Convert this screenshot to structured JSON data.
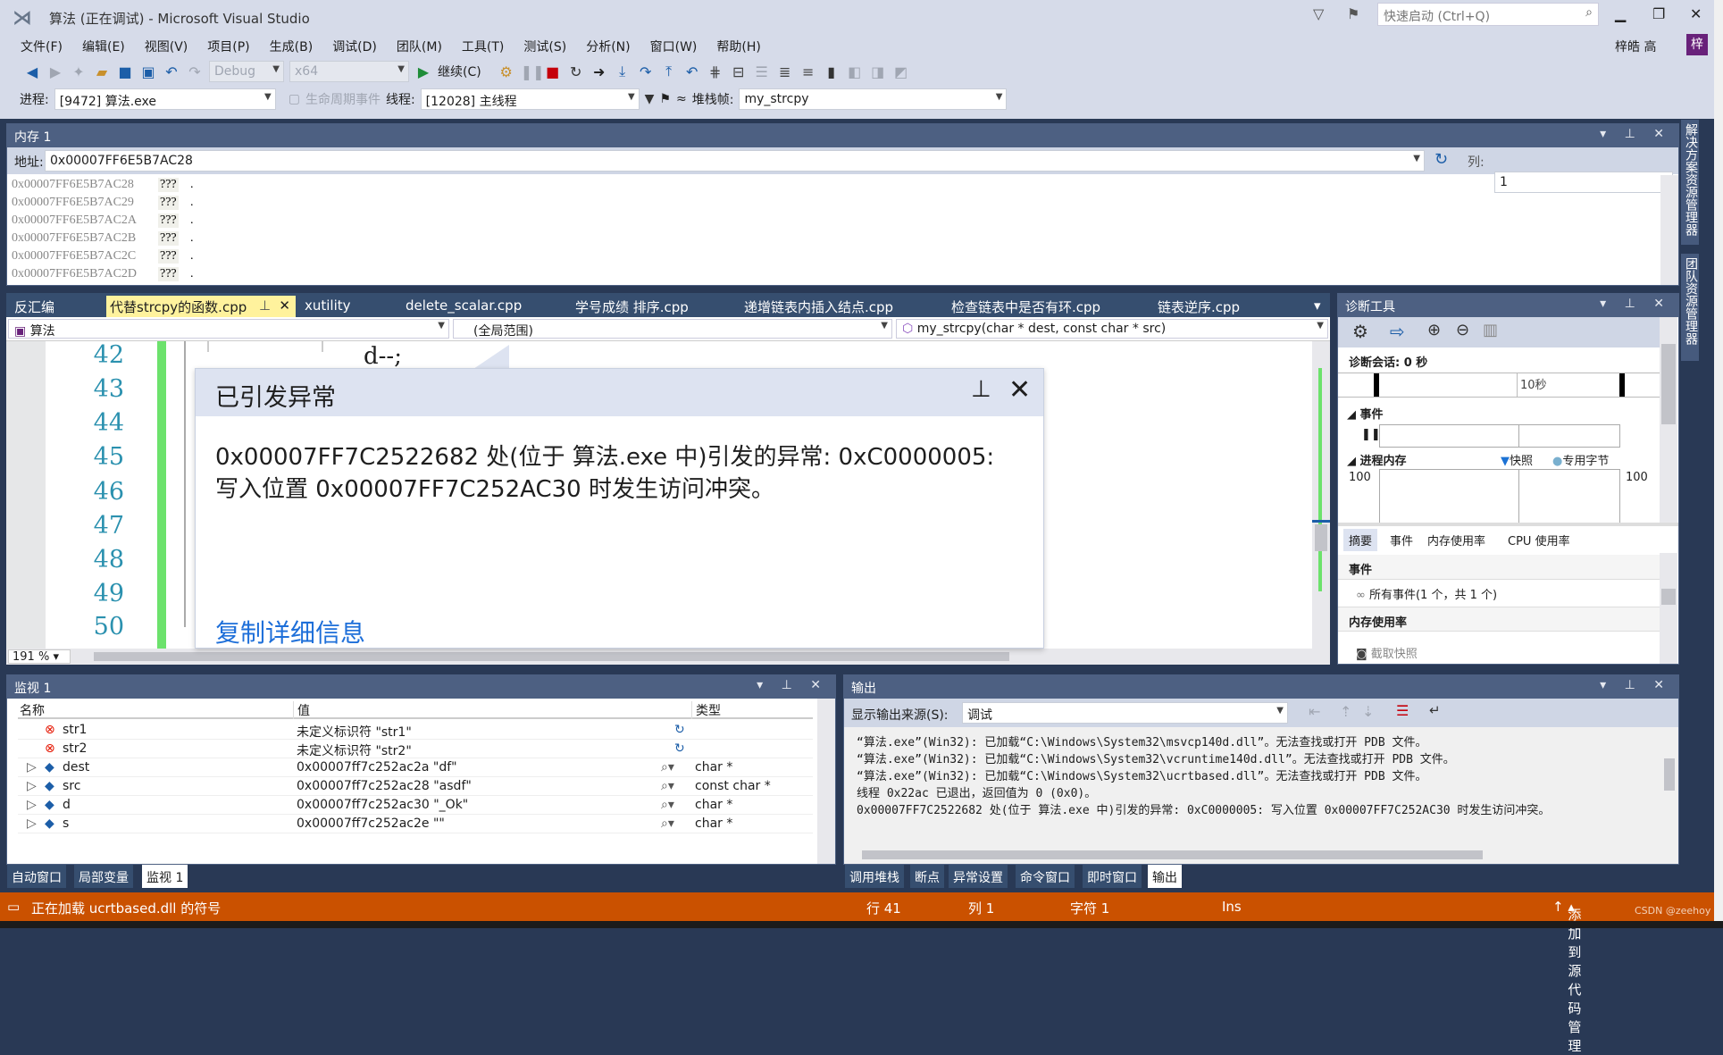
{
  "window": {
    "title": "算法 (正在调试) - Microsoft Visual Studio",
    "quick_launch_placeholder": "快速启动 (Ctrl+Q)",
    "user": "梓皓 高",
    "avatar": "梓"
  },
  "menu": [
    "文件(F)",
    "编辑(E)",
    "视图(V)",
    "项目(P)",
    "生成(B)",
    "调试(D)",
    "团队(M)",
    "工具(T)",
    "测试(S)",
    "分析(N)",
    "窗口(W)",
    "帮助(H)"
  ],
  "toolbar": {
    "config": "Debug",
    "platform": "x64",
    "continue": "继续(C)"
  },
  "debug_location": {
    "process_label": "进程:",
    "process": "[9472] 算法.exe",
    "lifecycle": "生命周期事件",
    "thread_label": "线程:",
    "thread": "[12028] 主线程",
    "stackframe_label": "堆栈帧:",
    "stackframe": "my_strcpy"
  },
  "memory": {
    "title": "内存 1",
    "address_label": "地址:",
    "address": "0x00007FF6E5B7AC28",
    "columns_label": "列:",
    "columns": "1",
    "rows": [
      {
        "addr": "0x00007FF6E5B7AC28",
        "val": "???",
        "ch": "."
      },
      {
        "addr": "0x00007FF6E5B7AC29",
        "val": "???",
        "ch": "."
      },
      {
        "addr": "0x00007FF6E5B7AC2A",
        "val": "???",
        "ch": "."
      },
      {
        "addr": "0x00007FF6E5B7AC2B",
        "val": "???",
        "ch": "."
      },
      {
        "addr": "0x00007FF6E5B7AC2C",
        "val": "???",
        "ch": "."
      },
      {
        "addr": "0x00007FF6E5B7AC2D",
        "val": "???",
        "ch": "."
      }
    ]
  },
  "editor": {
    "tabs": [
      "反汇编",
      "代替strcpy的函数.cpp",
      "xutility",
      "delete_scalar.cpp",
      "学号成绩 排序.cpp",
      "递增链表内插入结点.cpp",
      "检查链表中是否有环.cpp",
      "链表逆序.cpp"
    ],
    "active_tab": 1,
    "nav_project": "算法",
    "nav_scope": "(全局范围)",
    "nav_member": "my_strcpy(char * dest, const char * src)",
    "line_numbers": [
      "42",
      "43",
      "44",
      "45",
      "46",
      "47",
      "48",
      "49",
      "50"
    ],
    "code_line_42": "d--;",
    "zoom": "191 %"
  },
  "exception": {
    "title": "已引发异常",
    "message_line1": "0x00007FF7C2522682 处(位于 算法.exe 中)引发的异常: 0xC0000005:",
    "message_line2": "写入位置 0x00007FF7C252AC30 时发生访问冲突。",
    "copy_details": "复制详细信息"
  },
  "diagnostics": {
    "title": "诊断工具",
    "session": "诊断会话: 0 秒",
    "timeline_tick": "10秒",
    "events_section": "事件",
    "memory_section": "进程内存",
    "legend_snapshot": "快照",
    "legend_private": "专用字节",
    "axis_left": "100",
    "axis_right": "100",
    "tabs": [
      "摘要",
      "事件",
      "内存使用率",
      "CPU 使用率"
    ],
    "summary_events": "事件",
    "all_events": "所有事件(1 个，共 1 个)",
    "summary_memory": "内存使用率",
    "take_snapshot": "截取快照"
  },
  "watch": {
    "title": "监视 1",
    "columns": [
      "名称",
      "值",
      "类型"
    ],
    "rows": [
      {
        "name": "str1",
        "value": "未定义标识符 \"str1\"",
        "type": "",
        "error": true
      },
      {
        "name": "str2",
        "value": "未定义标识符 \"str2\"",
        "type": "",
        "error": true
      },
      {
        "name": "dest",
        "value": "0x00007ff7c252ac2a \"df\"",
        "type": "char *"
      },
      {
        "name": "src",
        "value": "0x00007ff7c252ac28 \"asdf\"",
        "type": "const char *"
      },
      {
        "name": "d",
        "value": "0x00007ff7c252ac30 \"_Ok\"",
        "type": "char *"
      },
      {
        "name": "s",
        "value": "0x00007ff7c252ac2e \"\"",
        "type": "char *"
      }
    ],
    "tabs": [
      "自动窗口",
      "局部变量",
      "监视 1"
    ]
  },
  "output": {
    "title": "输出",
    "source_label": "显示输出来源(S):",
    "source": "调试",
    "lines": [
      "“算法.exe”(Win32): 已加载“C:\\Windows\\System32\\msvcp140d.dll”。无法查找或打开 PDB 文件。",
      "“算法.exe”(Win32): 已加载“C:\\Windows\\System32\\vcruntime140d.dll”。无法查找或打开 PDB 文件。",
      "“算法.exe”(Win32): 已加载“C:\\Windows\\System32\\ucrtbased.dll”。无法查找或打开 PDB 文件。",
      "线程 0x22ac 已退出，返回值为 0 (0x0)。",
      "0x00007FF7C2522682 处(位于 算法.exe 中)引发的异常: 0xC0000005: 写入位置 0x00007FF7C252AC30 时发生访问冲突。"
    ],
    "tabs": [
      "调用堆栈",
      "断点",
      "异常设置",
      "命令窗口",
      "即时窗口",
      "输出"
    ]
  },
  "side_tabs": [
    "解决方案资源管理器",
    "团队资源管理器"
  ],
  "status": {
    "message": "正在加载 ucrtbased.dll 的符号",
    "line": "行 41",
    "col": "列 1",
    "char": "字符 1",
    "mode": "Ins",
    "source_control": "添加到源代码管理",
    "watermark": "CSDN @zeehoy"
  },
  "colors": {
    "status_bar": "#ca5100",
    "panel_header": "#4d6082",
    "active_tab": "#fff29d",
    "line_number": "#2b91af",
    "link": "#1e6fd9"
  }
}
